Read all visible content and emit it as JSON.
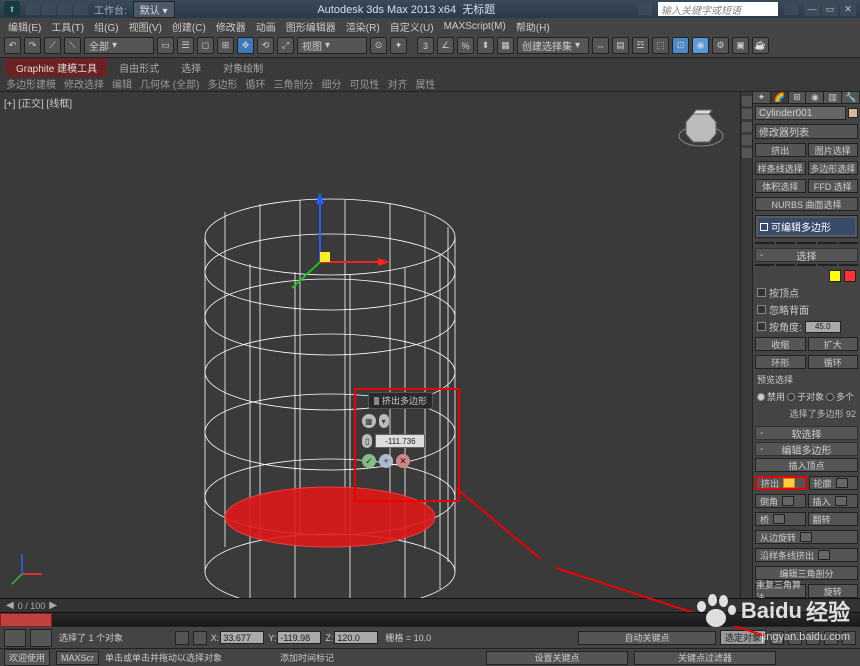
{
  "title": {
    "app": "Autodesk 3ds Max  2013  x64",
    "doc": "无标题",
    "workspace_label": "工作台:",
    "workspace_value": "默认",
    "search_placeholder": "输入关键字或短语"
  },
  "menu": [
    "编辑(E)",
    "工具(T)",
    "组(G)",
    "视图(V)",
    "创建(C)",
    "修改器",
    "动画",
    "图形编辑器",
    "渲染(R)",
    "自定义(U)",
    "MAXScript(M)",
    "帮助(H)"
  ],
  "toolbar": {
    "dd1": "全部",
    "dd2": "视图",
    "dd3": "创建选择集"
  },
  "ribbon": {
    "tabs": [
      "Graphite 建模工具",
      "自由形式",
      "选择",
      "对象绘制"
    ],
    "sub": [
      "多边形建模",
      "修改选择",
      "编辑",
      "几何体 (全部)",
      "多边形",
      "循环",
      "三角剖分",
      "细分",
      "可见性",
      "对齐",
      "属性"
    ]
  },
  "viewport": {
    "label": "[+] [正交] [线框]"
  },
  "caddy": {
    "title": "挤出多边形",
    "value": "-111.736"
  },
  "cmd": {
    "name": "Cylinder001",
    "mod_list_label": "修改器列表",
    "btns_a": [
      "挤出",
      "图片选择"
    ],
    "btns_b": [
      "样条线选择",
      "多边形选择"
    ],
    "btns_c": [
      "体积选择",
      "FFD 选择"
    ],
    "btns_d": "NURBS 曲面选择",
    "stack_item": "可编辑多边形",
    "rollout_sel": "选择",
    "chk_vertex": "按顶点",
    "chk_backface": "忽略背面",
    "chk_angle": "按角度:",
    "angle_val": "45.0",
    "btn_shrink": "收缩",
    "btn_grow": "扩大",
    "btn_ring": "环形",
    "btn_loop": "循环",
    "preview": "预览选择",
    "r1": "禁用",
    "r2": "子对象",
    "r3": "多个",
    "status": "选择了多边形 92",
    "rollout_soft": "软选择",
    "rollout_edit": "编辑多边形",
    "insert_v": "插入顶点",
    "e1": "挤出",
    "e2": "轮廓",
    "e3": "倒角",
    "e4": "插入",
    "e5": "桥",
    "e6": "翻转",
    "from_edge": "从边旋转",
    "along_spline": "沿样条线挤出",
    "edit_tri": "编辑三角剖分",
    "retri": "重复三角算法",
    "turn": "旋转"
  },
  "trackbar": {
    "frames": "0 / 100"
  },
  "status": {
    "sel": "选择了 1 个对象",
    "x": "33.677",
    "y": "-119.98",
    "z": "120.0",
    "grid": "栅格 = 10.0",
    "autokey": "自动关键点",
    "selset": "选定对象",
    "hint": "单击或单击并拖动以选择对象",
    "addtime": "添加时间标记",
    "welcome": "欢迎使用",
    "maxs": "MAXScr",
    "setkey": "设置关键点",
    "keyfilter": "关键点过滤器"
  },
  "watermark": {
    "brand": "Baidu",
    "brand2": "经验",
    "url": "jingyan.baidu.com"
  }
}
